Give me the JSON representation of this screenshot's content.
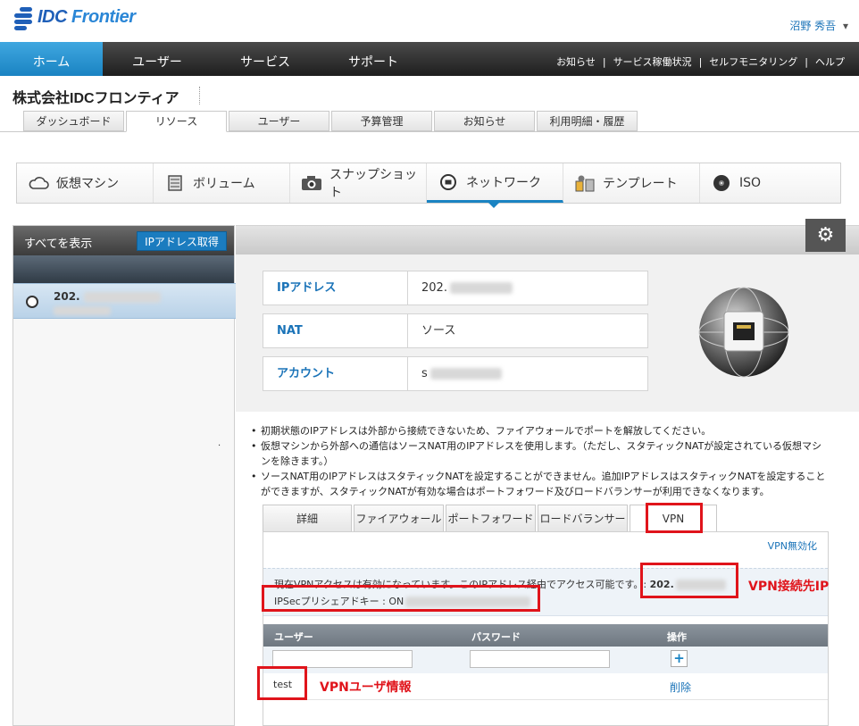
{
  "brand": {
    "name_a": "IDC ",
    "name_b": "Frontier"
  },
  "user": {
    "name": "沼野 秀吾",
    "caret": "▾"
  },
  "nav": {
    "items": [
      "ホーム",
      "ユーザー",
      "サービス",
      "サポート"
    ],
    "links": [
      "お知らせ",
      "|",
      "サービス稼働状況",
      "|",
      "セルフモニタリング",
      "|",
      "ヘルプ"
    ]
  },
  "company": "株式会社IDCフロンティア",
  "subtabs": [
    "ダッシュボード",
    "リソース",
    "ユーザー",
    "予算管理",
    "お知らせ",
    "利用明細・履歴"
  ],
  "resource_tabs": [
    {
      "label": "仮想マシン",
      "icon": "cloud-icon"
    },
    {
      "label": "ボリューム",
      "icon": "volume-icon"
    },
    {
      "label": "スナップショット",
      "icon": "camera-icon"
    },
    {
      "label": "ネットワーク",
      "icon": "network-icon"
    },
    {
      "label": "テンプレート",
      "icon": "template-icon"
    },
    {
      "label": "ISO",
      "icon": "disc-icon"
    }
  ],
  "sidebar": {
    "show_all": "すべてを表示",
    "get_ip": "IPアドレス取得",
    "item_ip": "202."
  },
  "detail": {
    "ip_label": "IPアドレス",
    "ip_value": "202.",
    "nat_label": "NAT",
    "nat_value": "ソース",
    "account_label": "アカウント",
    "account_value": "s"
  },
  "notes": [
    "初期状態のIPアドレスは外部から接続できないため、ファイアウォールでポートを解放してください。",
    "仮想マシンから外部への通信はソースNAT用のIPアドレスを使用します。（ただし、スタティックNATが設定されている仮想マシンを除きます。）",
    "ソースNAT用のIPアドレスはスタティックNATを設定することができません。追加IPアドレスはスタティックNATを設定することができますが、スタティックNATが有効な場合はポートフォワード及びロードバランサーが利用できなくなります。"
  ],
  "detail_tabs": [
    "詳細",
    "ファイアウォール",
    "ポートフォワード",
    "ロードバランサー",
    "VPN"
  ],
  "vpn": {
    "disable": "VPN無効化",
    "status_text": "現在VPNアクセスは有効になっています。このIPアドレス経由でアクセス可能です。:",
    "status_ip": "202.",
    "psk_label": "IPSecプリシェアドキー : ON",
    "col_user": "ユーザー",
    "col_password": "パスワード",
    "col_action": "操作",
    "add": "+",
    "row_user": "test",
    "row_delete": "削除"
  },
  "annotations": {
    "vpn_ip": "VPN接続先IP",
    "vpn_user": "VPNユーザ情報"
  },
  "colors": {
    "accent": "#1a83c2",
    "annotation": "#e0141b"
  }
}
